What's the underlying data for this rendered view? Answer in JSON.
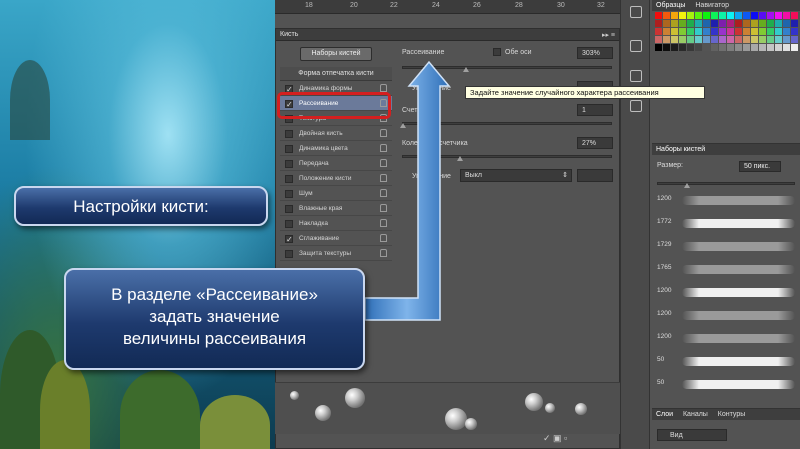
{
  "ruler": {
    "ticks": [
      "18",
      "20",
      "22",
      "24",
      "26",
      "28",
      "30",
      "32"
    ]
  },
  "brush_panel": {
    "title": "Кисть",
    "presets_button": "Наборы кистей",
    "list_header": "Форма отпечатка кисти",
    "items": [
      {
        "label": "Динамика формы",
        "checked": true
      },
      {
        "label": "Рассеивание",
        "checked": true,
        "selected": true
      },
      {
        "label": "Текстура",
        "checked": false
      },
      {
        "label": "Двойная кисть",
        "checked": false
      },
      {
        "label": "Динамика цвета",
        "checked": false
      },
      {
        "label": "Передача",
        "checked": false
      },
      {
        "label": "Положение кисти",
        "checked": false
      },
      {
        "label": "Шум",
        "checked": false
      },
      {
        "label": "Влажные края",
        "checked": false
      },
      {
        "label": "Накладка",
        "checked": false
      },
      {
        "label": "Сглаживание",
        "checked": true
      },
      {
        "label": "Защита текстуры",
        "checked": false
      }
    ],
    "scatter_label": "Рассеивание",
    "both_axes_label": "Обе оси",
    "scatter_value": "303%",
    "control_label_1": "Управление",
    "count_label": "Счетчик",
    "count_value": "1",
    "count_jitter_label": "Колебание счетчика",
    "count_jitter_value": "27%",
    "control_label_2": "Управление",
    "control_value": "Выкл",
    "tooltip": "Задайте значение случайного характера рассеивания"
  },
  "swatches": {
    "tabs": [
      "Образцы",
      "Навигатор"
    ]
  },
  "presets_panel": {
    "title": "Наборы кистей",
    "size_label": "Размер:",
    "size_value": "50 пикс.",
    "rows": [
      "1200",
      "1772",
      "1729",
      "1765",
      "1200",
      "1200",
      "1200",
      "50",
      "50"
    ]
  },
  "layers_panel": {
    "tabs": [
      "Слои",
      "Каналы",
      "Контуры"
    ],
    "kind_value": "Вид"
  },
  "callouts": {
    "title": "Настройки кисти:",
    "line1": "В разделе «Рассеивание»",
    "line2": "задать значение",
    "line3": "величины рассеивания"
  },
  "colors": {
    "highlight": "#d41f1f",
    "callout": "#1e3a6e",
    "panel": "#535353"
  }
}
